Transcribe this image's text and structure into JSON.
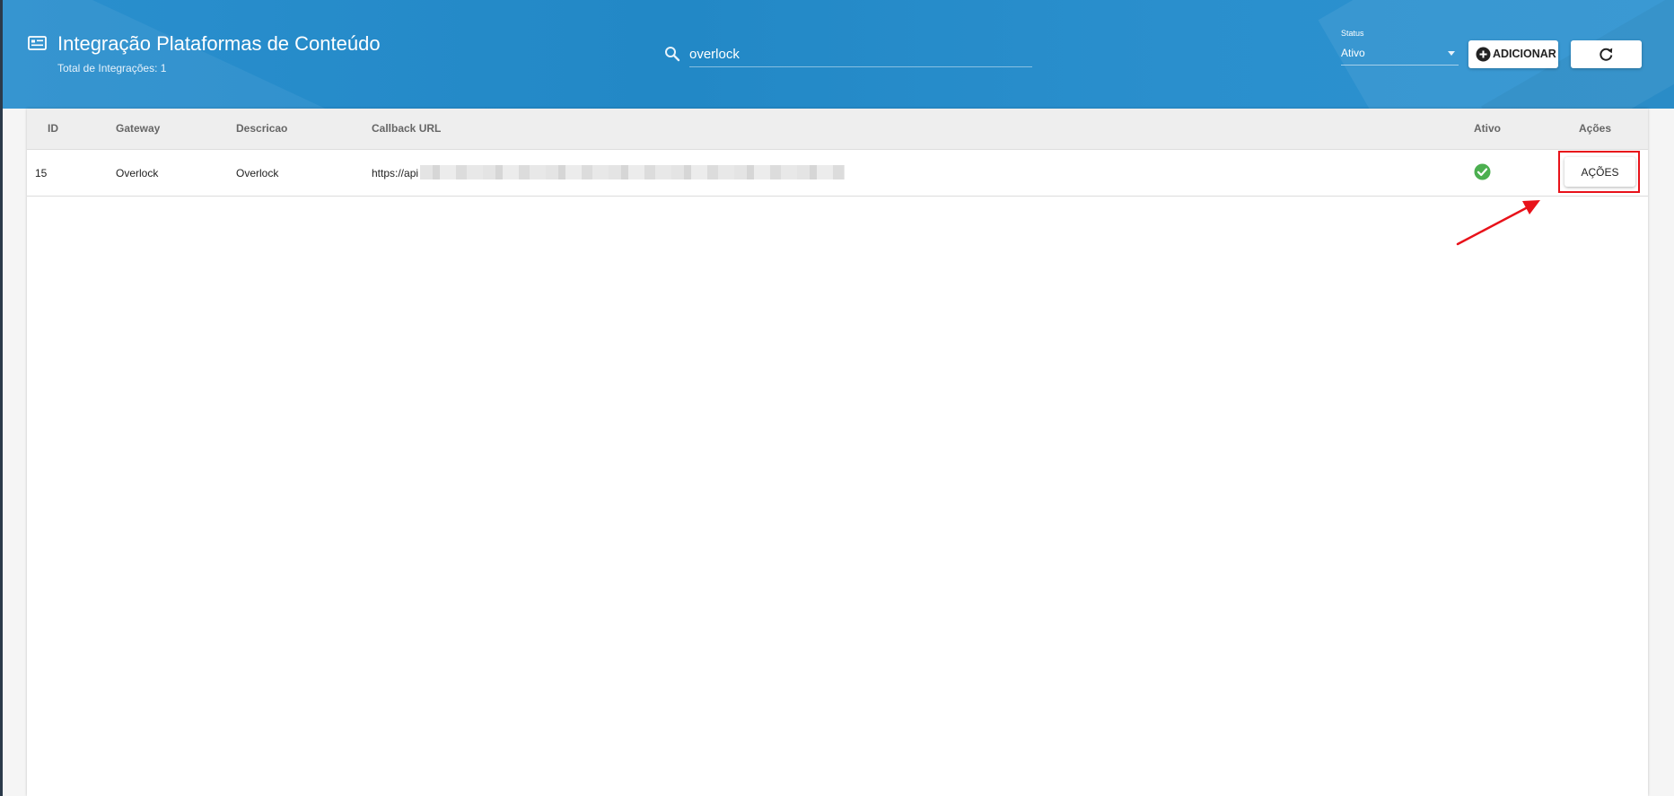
{
  "header": {
    "title": "Integração Plataformas de Conteúdo",
    "subtitle": "Total de Integrações: 1",
    "icon": "list-card-icon"
  },
  "search": {
    "value": "overlock",
    "placeholder": "",
    "icon": "search-icon"
  },
  "status_filter": {
    "label": "Status",
    "selected": "Ativo"
  },
  "buttons": {
    "add_label": "ADICIONAR",
    "add_icon": "plus-circle-icon",
    "refresh_icon": "refresh-icon"
  },
  "table": {
    "columns": [
      "ID",
      "Gateway",
      "Descricao",
      "Callback URL",
      "Ativo",
      "Ações"
    ],
    "rows": [
      {
        "id": "15",
        "gateway": "Overlock",
        "descricao": "Overlock",
        "callback_url": "https://api",
        "ativo": true,
        "action_label": "AÇÕES"
      }
    ]
  },
  "colors": {
    "header_blue": "#2288c6",
    "active_green": "#4caf50",
    "highlight_red": "#e8121a"
  }
}
